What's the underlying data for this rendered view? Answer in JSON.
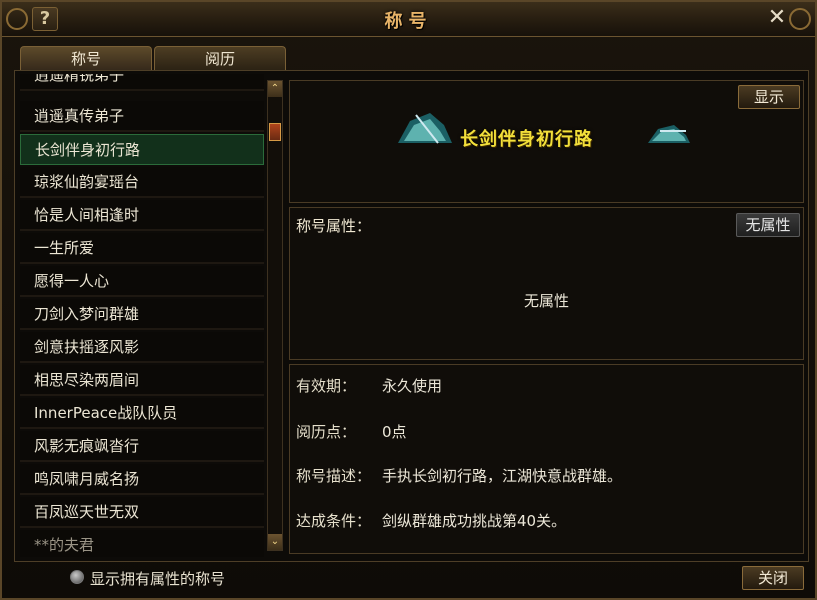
{
  "window": {
    "title": "称号",
    "help_label": "?",
    "close_label": "✕"
  },
  "tabs": [
    {
      "label": "称号"
    },
    {
      "label": "阅历"
    }
  ],
  "titles_list": [
    {
      "label": "逍遥精锐弟子"
    },
    {
      "label": "逍遥真传弟子"
    },
    {
      "label": "长剑伴身初行路"
    },
    {
      "label": "琼浆仙韵宴瑶台"
    },
    {
      "label": "恰是人间相逢时"
    },
    {
      "label": "一生所爱"
    },
    {
      "label": "愿得一人心"
    },
    {
      "label": "刀剑入梦问群雄"
    },
    {
      "label": "剑意扶摇逐风影"
    },
    {
      "label": "相思尽染两眉间"
    },
    {
      "label": "InnerPeace战队队员"
    },
    {
      "label": "风影无痕飒沓行"
    },
    {
      "label": "鸣凤啸月威名扬"
    },
    {
      "label": "百凤巡天世无双"
    },
    {
      "label": "**的夫君"
    }
  ],
  "selected_index": 2,
  "display_button": "显示",
  "title_banner": "长剑伴身初行路",
  "attributes": {
    "heading": "称号属性：",
    "button": "无属性",
    "content": "无属性"
  },
  "details": {
    "validity_label": "有效期：",
    "validity_value": "永久使用",
    "points_label": "阅历点：",
    "points_value": "0点",
    "desc_label": "称号描述：",
    "desc_value": "手执长剑初行路，江湖快意战群雄。",
    "cond_label": "达成条件：",
    "cond_value": "剑纵群雄成功挑战第40关。"
  },
  "footer": {
    "checkbox_label": "显示拥有属性的称号",
    "close_button": "关闭"
  },
  "colors": {
    "accent_gold": "#e8b468",
    "banner_yellow": "#f2df3a",
    "selected_green": "#12301b"
  }
}
